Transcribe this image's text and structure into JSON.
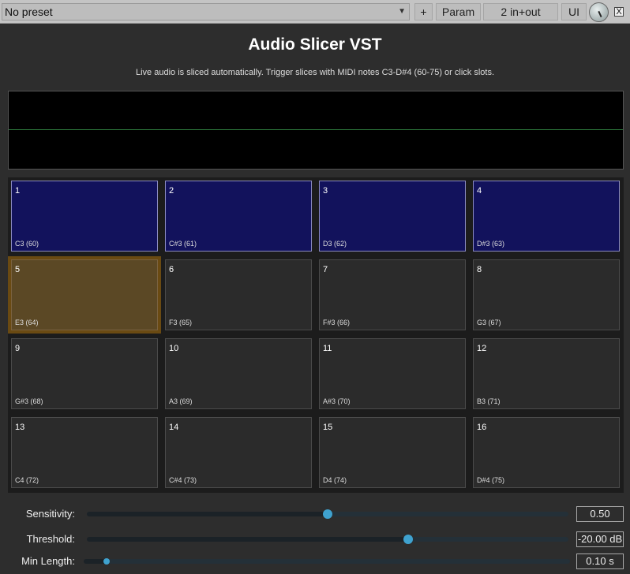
{
  "toolbar": {
    "preset": "No preset",
    "plus": "+",
    "param": "Param",
    "io": "2 in+out",
    "ui": "UI",
    "close": "X"
  },
  "header": {
    "title": "Audio Slicer VST",
    "subtitle": "Live audio is sliced automatically. Trigger slices with MIDI notes C3-D#4 (60-75) or click slots."
  },
  "slots": [
    {
      "num": "1",
      "note": "C3 (60)",
      "state": "filled"
    },
    {
      "num": "2",
      "note": "C#3 (61)",
      "state": "filled"
    },
    {
      "num": "3",
      "note": "D3 (62)",
      "state": "filled"
    },
    {
      "num": "4",
      "note": "D#3 (63)",
      "state": "filled"
    },
    {
      "num": "5",
      "note": "E3 (64)",
      "state": "active"
    },
    {
      "num": "6",
      "note": "F3 (65)",
      "state": "empty"
    },
    {
      "num": "7",
      "note": "F#3 (66)",
      "state": "empty"
    },
    {
      "num": "8",
      "note": "G3 (67)",
      "state": "empty"
    },
    {
      "num": "9",
      "note": "G#3 (68)",
      "state": "empty"
    },
    {
      "num": "10",
      "note": "A3 (69)",
      "state": "empty"
    },
    {
      "num": "11",
      "note": "A#3 (70)",
      "state": "empty"
    },
    {
      "num": "12",
      "note": "B3 (71)",
      "state": "empty"
    },
    {
      "num": "13",
      "note": "C4 (72)",
      "state": "empty"
    },
    {
      "num": "14",
      "note": "C#4 (73)",
      "state": "empty"
    },
    {
      "num": "15",
      "note": "D4 (74)",
      "state": "empty"
    },
    {
      "num": "16",
      "note": "D#4 (75)",
      "state": "empty"
    }
  ],
  "sliders": [
    {
      "label": "Sensitivity:",
      "value": "0.50",
      "fraction": 0.5
    },
    {
      "label": "Threshold:",
      "value": "-20.00 dB",
      "fraction": 0.667
    },
    {
      "label": "Min Length:",
      "value": "0.10 s",
      "fraction": 0.047
    }
  ]
}
